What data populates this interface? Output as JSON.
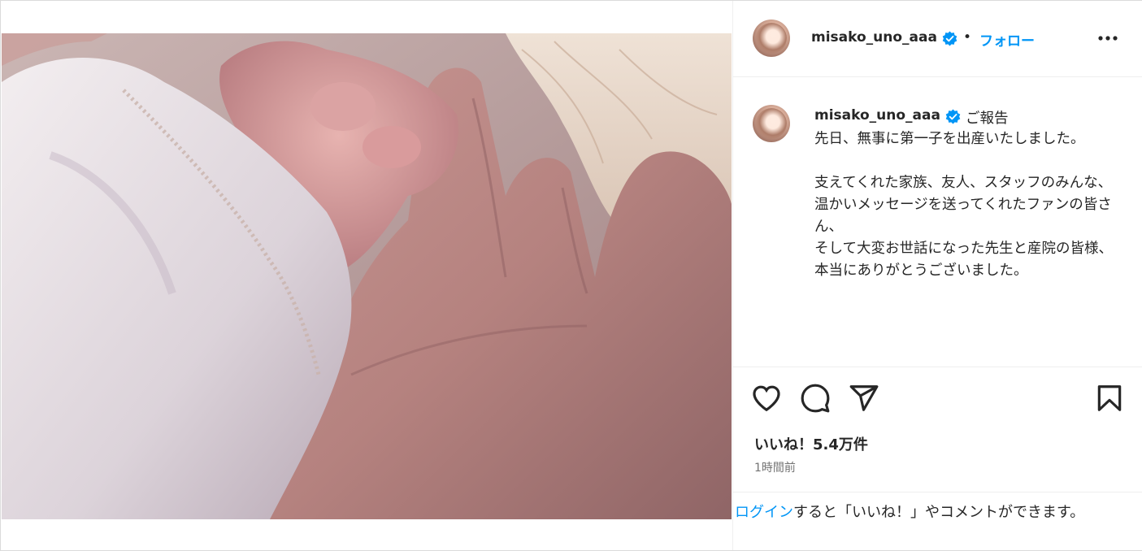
{
  "post": {
    "username": "misako_uno_aaa",
    "dot": "•",
    "follow_label": "フォロー",
    "caption_title": "ご報告",
    "caption_body": "先日、無事に第一子を出産いたしました。\n\n支えてくれた家族、友人、スタッフのみんな、\n温かいメッセージを送ってくれたファンの皆さん、\nそして大変お世話になった先生と産院の皆様、\n本当にありがとうございました。",
    "likes": "いいね！5.4万件",
    "timestamp": "1時間前",
    "login_link": "ログイン",
    "login_text": "すると「いいね！」やコメントができます。"
  },
  "icons": {
    "more": "more-options-icon",
    "like": "heart-icon",
    "comment": "comment-icon",
    "share": "share-icon",
    "save": "bookmark-icon",
    "verified": "verified-badge-icon"
  },
  "colors": {
    "accent": "#0095f6",
    "text": "#262626",
    "muted": "#737373",
    "border": "#efefef"
  }
}
